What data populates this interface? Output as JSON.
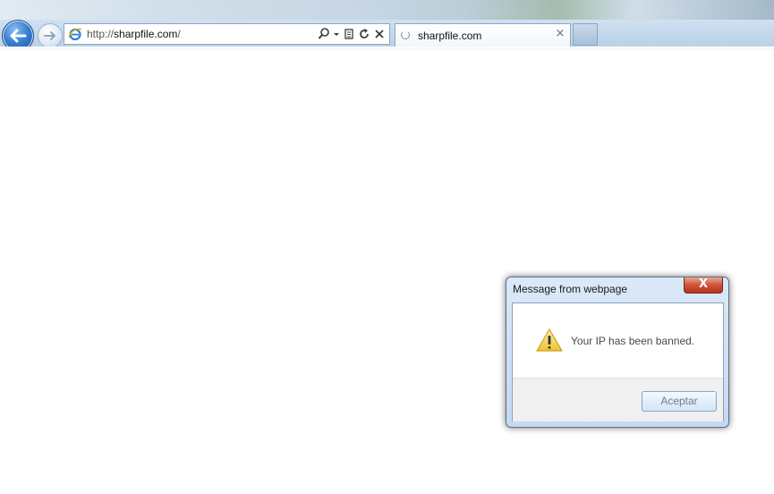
{
  "browser": {
    "address_bar": {
      "url_prefix": "http://",
      "url_domain": "sharpfile.com",
      "url_suffix": "/"
    },
    "tab": {
      "title": "sharpfile.com",
      "close_glyph": "×"
    },
    "icons": [
      "back-arrow-icon",
      "forward-arrow-icon",
      "ie-logo-icon",
      "search-icon",
      "dropdown-arrow-icon",
      "compatibility-view-icon",
      "refresh-icon",
      "stop-icon",
      "loading-spinner-icon",
      "close-icon",
      "new-tab-icon"
    ]
  },
  "dialog": {
    "title": "Message from webpage",
    "close_glyph": "X",
    "message": "Your IP has been banned.",
    "ok_label": "Aceptar",
    "icon": "warning-icon"
  }
}
